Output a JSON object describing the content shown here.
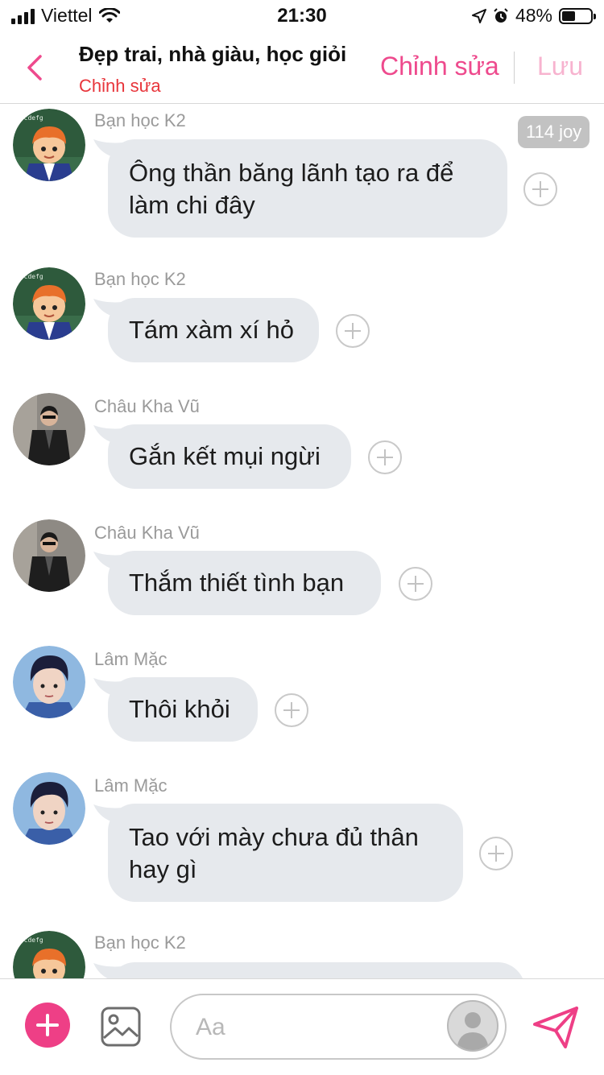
{
  "status_bar": {
    "carrier": "Viettel",
    "time": "21:30",
    "battery": "48%",
    "battery_level": 0.48
  },
  "header": {
    "title": "Đẹp trai, nhà giàu, học giỏi",
    "subtitle": "Chỉnh sửa",
    "edit_label": "Chỉnh sửa",
    "save_label": "Lưu"
  },
  "colors": {
    "accent": "#ee3f86",
    "subtitle_red": "#e8353b",
    "bubble": "#e6e9ed"
  },
  "joy_badge": "114 joy",
  "messages": [
    {
      "sender": "Bạn học K2",
      "text": "Ông thần băng lãnh tạo ra để làm chi đây",
      "avatar": "cartoon-student"
    },
    {
      "sender": "Bạn học K2",
      "text": "Tám xàm xí hỏ",
      "avatar": "cartoon-student"
    },
    {
      "sender": "Châu Kha Vũ",
      "text": "Gắn kết mụi ngừi",
      "avatar": "man-in-black-coat"
    },
    {
      "sender": "Châu Kha Vũ",
      "text": "Thắm thiết tình bạn",
      "avatar": "man-in-black-coat"
    },
    {
      "sender": "Lâm Mặc",
      "text": "Thôi khỏi",
      "avatar": "young-man-portrait"
    },
    {
      "sender": "Lâm Mặc",
      "text": "Tao với mày chưa đủ thân hay gì",
      "avatar": "young-man-portrait"
    },
    {
      "sender": "Bạn học K2",
      "text": "",
      "avatar": "cartoon-student"
    }
  ],
  "composer": {
    "placeholder": "Aa"
  },
  "icons": [
    "back-chevron-icon",
    "add-icon",
    "image-icon",
    "user-avatar-icon",
    "send-icon",
    "react-plus-icon"
  ]
}
